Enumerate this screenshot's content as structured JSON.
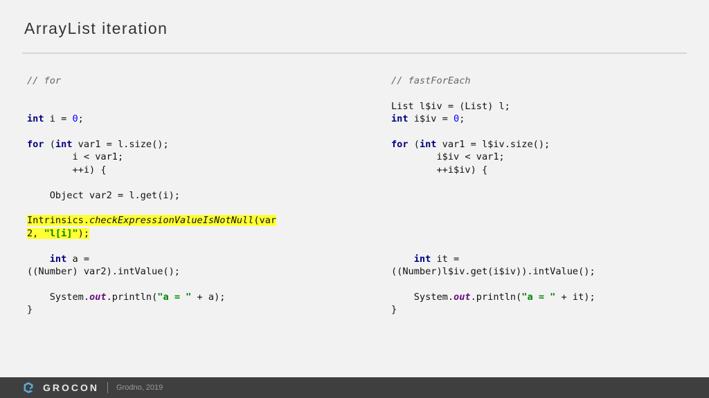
{
  "slide": {
    "title": "ArrayList iteration"
  },
  "left_code": {
    "comment": "// for",
    "l1_kw": "int",
    "l1_rest": " i = ",
    "l1_num": "0",
    "l1_end": ";",
    "l2_kw": "for",
    "l2_mid": " (",
    "l2_kw2": "int",
    "l2_rest": " var1 = l.size();",
    "l3": "        i < var1;",
    "l4": "        ++i) {",
    "l5": "    Object var2 = l.get(i);",
    "l6_a": "Intrinsics.",
    "l6_m": "checkExpressionValueIsNotNull",
    "l6_b": "(var",
    "l7_a": "2, ",
    "l7_s": "\"l[i]\"",
    "l7_b": ");",
    "l8_indent": "    ",
    "l8_kw": "int",
    "l8_rest": " a =",
    "l9": "((Number) var2).intValue();",
    "l10_a": "    System.",
    "l10_f": "out",
    "l10_b": ".println(",
    "l10_s": "\"a = \"",
    "l10_c": " + a);",
    "l11": "}"
  },
  "right_code": {
    "comment": "// fastForEach",
    "l1": "List l$iv = (List) l;",
    "l2_kw": "int",
    "l2_rest": " i$iv = ",
    "l2_num": "0",
    "l2_end": ";",
    "l3_kw": "for",
    "l3_mid": " (",
    "l3_kw2": "int",
    "l3_rest": " var1 = l$iv.size();",
    "l4": "        i$iv < var1;",
    "l5": "        ++i$iv) {",
    "l6_indent": "    ",
    "l6_kw": "int",
    "l6_rest": " it =",
    "l7": "((Number)l$iv.get(i$iv)).intValue();",
    "l8_a": "    System.",
    "l8_f": "out",
    "l8_b": ".println(",
    "l8_s": "\"a = \"",
    "l8_c": " + it);",
    "l9": "}"
  },
  "footer": {
    "logo_text": "GROCON",
    "event": "Grodno, 2019",
    "icon": "grocon-logo-icon"
  },
  "colors": {
    "background": "#f2f2f2",
    "footer": "#3f3f3f",
    "highlight": "#ffff33",
    "keyword": "#000080",
    "string": "#008000",
    "number": "#0000ff"
  }
}
